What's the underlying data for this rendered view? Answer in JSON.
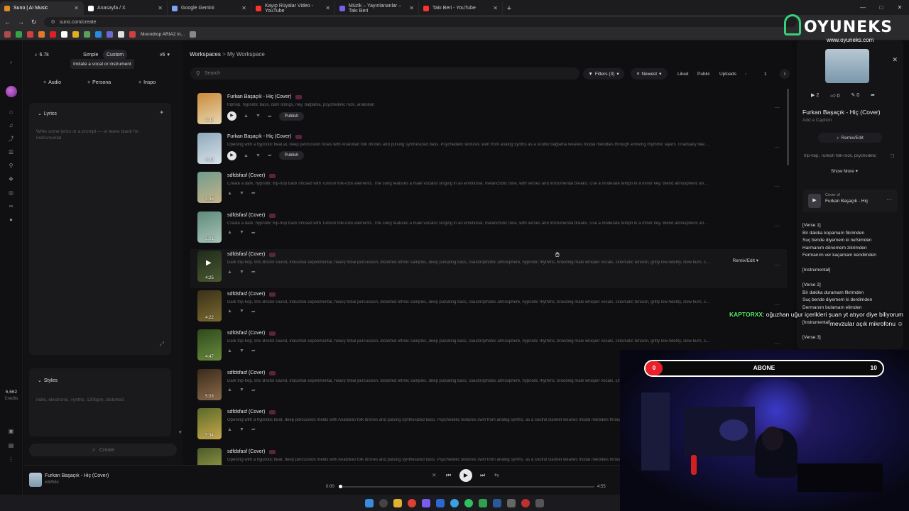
{
  "browser": {
    "tabs": [
      {
        "label": "Suno | AI Music",
        "color": "#e08a2a",
        "active": true
      },
      {
        "label": "Anasayfa / X",
        "color": "#ffffff",
        "active": false
      },
      {
        "label": "Google Gemini",
        "color": "#7aa6f5",
        "active": false
      },
      {
        "label": "Kayıp Rüyalar Video - YouTube",
        "color": "#ff3030",
        "active": false
      },
      {
        "label": "Müzik – Yayınlananlar – Takı Beri",
        "color": "#7a5cf0",
        "active": false
      },
      {
        "label": "Takı Beri - YouTube",
        "color": "#ff3030",
        "active": false
      }
    ],
    "url": "suno.com/create",
    "bookmark_label": "Moondrop ARIA2 In..."
  },
  "rail": {
    "credits_value": "6,662",
    "credits_label": "Credits"
  },
  "create": {
    "count": "6.7k",
    "mode_simple": "Simple",
    "mode_custom": "Custom",
    "tooltip": "Imitate a vocal or instrument",
    "version": "v6",
    "audio": "Audio",
    "persona": "Persona",
    "inspo": "Inspo",
    "lyrics_label": "Lyrics",
    "lyrics_placeholder": "Write some lyrics or a prompt — or leave blank for instrumental",
    "styles_label": "Styles",
    "styles_placeholder": "indie, electronic, synths, 120bpm, distorted",
    "create_btn": "Create"
  },
  "workspace": {
    "crumb_root": "Workspaces",
    "crumb_sep": ">",
    "crumb_current": "My Workspace",
    "search_placeholder": "Search",
    "filters": "Filters (3)",
    "sort": "Newest",
    "liked": "Liked",
    "public": "Public",
    "uploads": "Uploads",
    "page": "1",
    "publish": "Publish",
    "remix": "Remix/Edit",
    "songs": [
      {
        "title": "Furkan Başaçık - Hiç (Cover)",
        "desc": "triphop, hypnotic bass, dark strings, ney, bağlama, psychedelic rock, anatolian",
        "dur": "4:42",
        "c1": "#c98a3a",
        "c2": "#e8d8b0",
        "publish": true
      },
      {
        "title": "Furkan Başaçık - Hiç (Cover)",
        "desc": "Opening with a hypnotic beat,at, deep percussion fuses with Anatolian folk drones and pulsing synthesized bass. Psychedelic textures swirl from analog synths as a soulful bağlama weaves modal melodies through evolving rhythmic layers. Gradually deep minor strings...",
        "dur": "4:49",
        "c1": "#8fa9bb",
        "c2": "#d8e2ea",
        "publish": true
      },
      {
        "title": "sdfdsfasf (Cover)",
        "desc": "Create a dark, hypnotic trip-hop track infused with Turkish folk-rock elements. The song features a male vocalist singing in an emotional, melancholic tone, with verses and instrumental breaks. Use a moderate tempo in a minor key. Blend atmospheric analog synth pads, r...",
        "dur": "4:46",
        "c1": "#6e9c8c",
        "c2": "#c8b48a",
        "publish": false
      },
      {
        "title": "sdfdsfasf (Cover)",
        "desc": "Create a dark, hypnotic trip-hop track infused with Turkish folk-rock elements. The song features a male vocalist singing in an emotional, melancholic tone, with verses and instrumental breaks. Use a moderate tempo in a minor key. Blend atmospheric analog synth pads, r...",
        "dur": "5:01",
        "c1": "#5e8a7a",
        "c2": "#a9c4b8",
        "publish": false
      },
      {
        "title": "sdfdsfasf (Cover)",
        "desc": "Dark trip-hop, 90s Bristol sound, industrial experimental, heavy tribal percussion, distorted ethnic samples, deep pulsating bass, claustrophobic atmosphere, hypnotic rhythms, brooding male whisper vocals, cinematic tension, gritty low-fidelity, slow burn, syncopated drums",
        "dur": "4:25",
        "c1": "#1f2a1a",
        "c2": "#4a5a30",
        "publish": false,
        "hover": true
      },
      {
        "title": "sdfdsfasf (Cover)",
        "desc": "Dark trip-hop, 90s Bristol sound, industrial experimental, heavy tribal percussion, distorted ethnic samples, deep pulsating bass, claustrophobic atmosphere, hypnotic rhythms, brooding male whisper vocals, cinematic tension, gritty low-fidelity, slow burn, syncopated drums",
        "dur": "4:22",
        "c1": "#3a3018",
        "c2": "#7a6a30",
        "publish": false
      },
      {
        "title": "sdfdsfasf (Cover)",
        "desc": "Dark trip-hop, 90s Bristol sound, industrial experimental, heavy tribal percussion, distorted ethnic samples, deep pulsating bass, claustrophobic atmosphere, hypnotic rhythms, brooding male whisper vocals, cinematic tension, gritty low-fidelity, slow burn, syncopated drums",
        "dur": "4:47",
        "c1": "#2e4a1e",
        "c2": "#6a8a3a",
        "publish": false
      },
      {
        "title": "sdfdsfasf (Cover)",
        "desc": "Dark trip-hop, 90s Bristol sound, industrial experimental, heavy tribal percussion, distorted ethnic samples, deep pulsating bass, claustrophobic atmosphere, hypnotic rhythms, brooding male whisper vocals, cinematic tension, gritty low-fidelity, slow burn, syncopated drums",
        "dur": "5:03",
        "c1": "#3a2a1a",
        "c2": "#8a6a4a",
        "publish": false
      },
      {
        "title": "sdfdsfasf (Cover)",
        "desc": "Opening with a hypnotic beat, deep percussion melds with Anatolian folk drones and pulsing synthesized bass. Psychedelic textures swirl from analog synths, as a soulful clarinet weaves modal melodies throughout, both",
        "dur": "5:34",
        "c1": "#5a6a2a",
        "c2": "#c8a84a",
        "publish": false
      },
      {
        "title": "sdfdsfasf (Cover)",
        "desc": "Opening with a hypnotic beat, deep percussion melds with Anatolian folk drones and pulsing synthesized bass. Psychedelic textures swirl from analog synths, as a soulful clarinet weaves modal melodies throughout, both",
        "dur": "",
        "c1": "#4a5a2a",
        "c2": "#a8a84a",
        "publish": false
      }
    ]
  },
  "detail": {
    "plays": "2",
    "likes": "0",
    "comments": "0",
    "title": "Furkan Başaçık - Hiç (Cover)",
    "caption": "Add a Caption",
    "remix": "Remix/Edit",
    "tags": "trip-hop, Turkish folk-rock, psychedelic",
    "show_more": "Show More",
    "cover_of": "Cover of",
    "cover_title": "Furkan Başaçık - Hiç",
    "lyrics": [
      "[Verse 1]",
      "Bir dakika kopamam fikrimden",
      "Suç bende diyemem ki nefsimden",
      "Harmanım dönemem zikrimden",
      "Fermanım ver kaçamam kendimden",
      "",
      "[Instrumental]",
      "",
      "[Verse 2]",
      "Bir dakika duramam fikrimden",
      "Suç bende diyemem ki derdimden",
      "Dermanım bulamam elimden",
      "",
      "[Instrumental]",
      "",
      "[Verse 3]"
    ]
  },
  "player": {
    "title": "Furkan Başaçık - Hiç (Cover)",
    "artist": "wWhite",
    "elapsed": "0:00",
    "total": "4:55",
    "progress": 0.0
  },
  "overlay": {
    "brand": "OYUNEKS",
    "site": "www.oyuneks.com",
    "chat_user": "KAPTORXX",
    "chat_msg": ": oğuzhan uğur içerikleri şuan yt atıyor diye biliyorum mevzular açık mikrofonu",
    "bar_left": "0",
    "bar_label": "ABONE",
    "bar_right": "10"
  }
}
